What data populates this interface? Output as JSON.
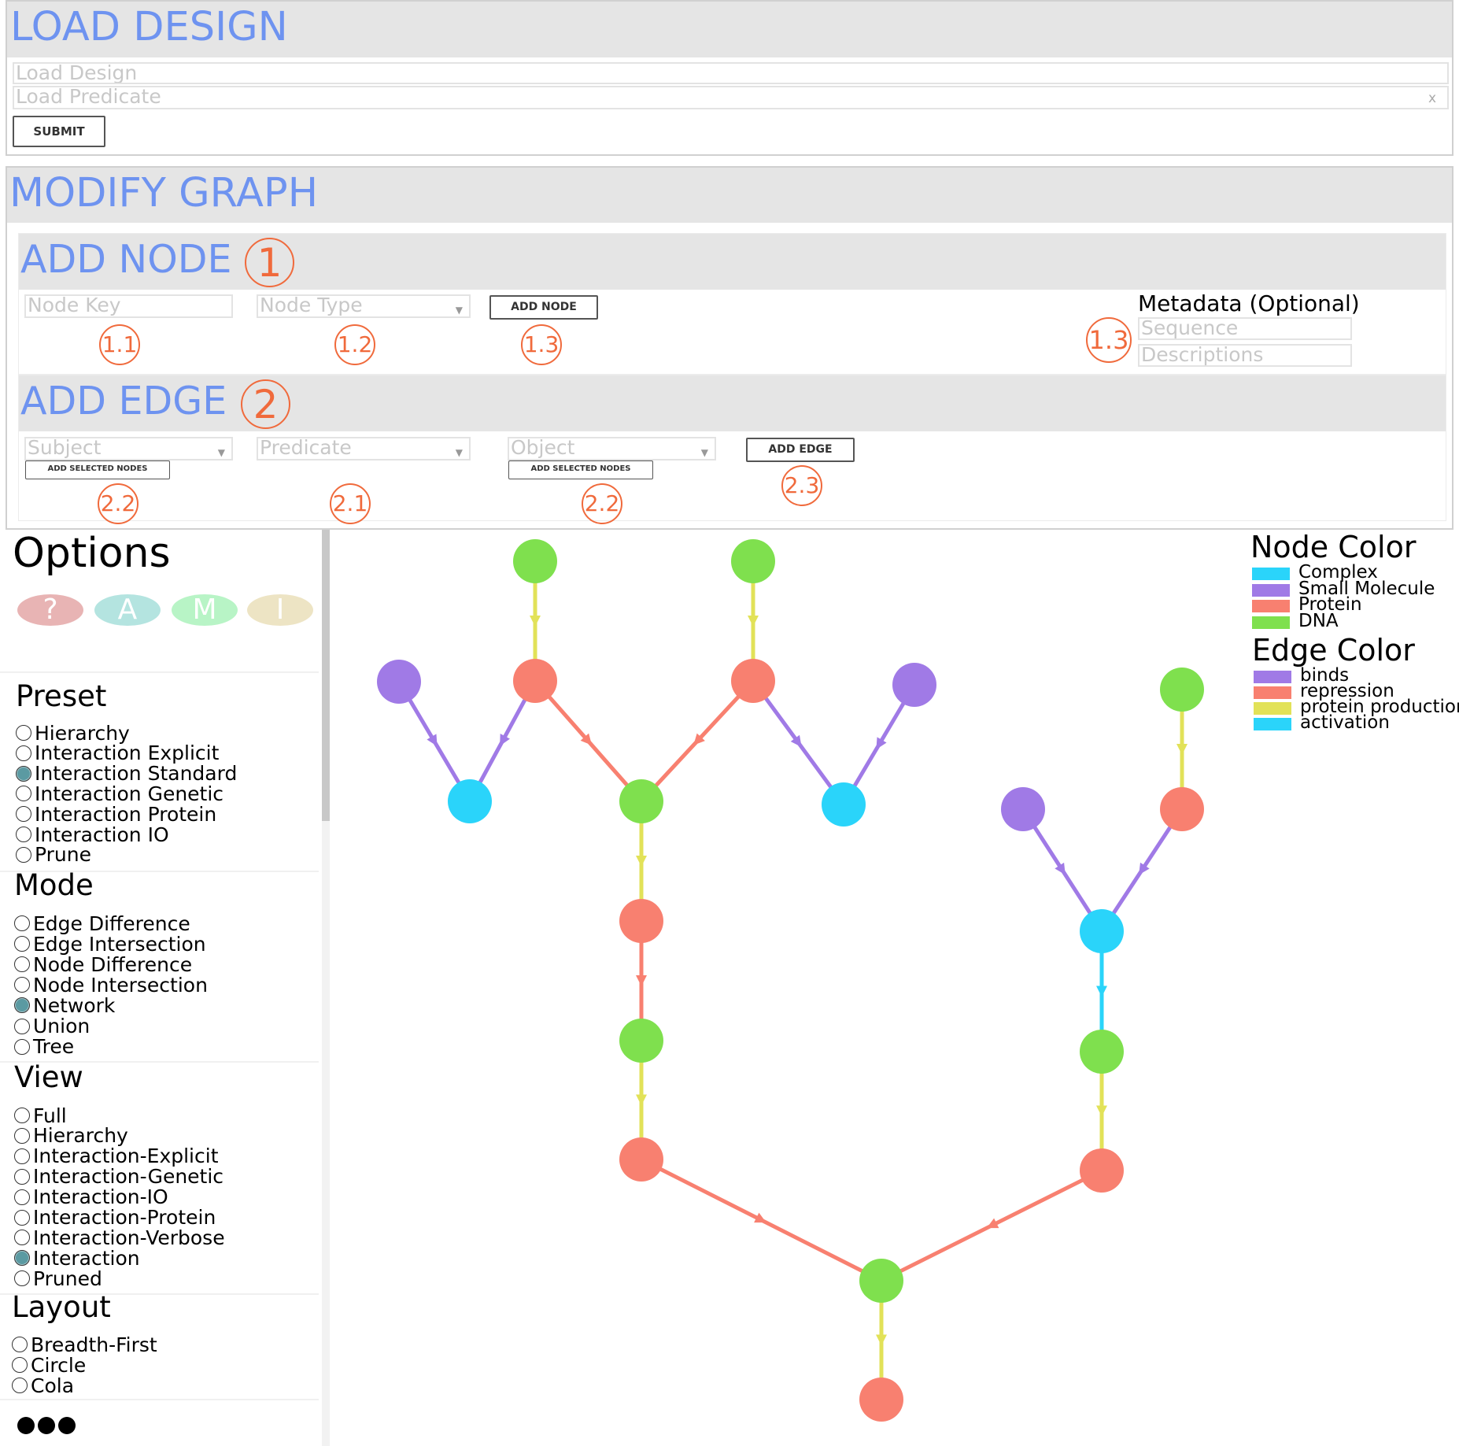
{
  "load_design": {
    "title": "LOAD DESIGN",
    "design_placeholder": "Load Design",
    "predicate_placeholder": "Load Predicate",
    "clear_label": "x",
    "submit_label": "SUBMIT"
  },
  "modify_graph": {
    "title": "MODIFY GRAPH",
    "add_node": {
      "title": "ADD NODE",
      "step": "1",
      "node_key_placeholder": "Node Key",
      "node_type_placeholder": "Node Type",
      "add_node_label": "ADD NODE",
      "metadata_title": "Metadata (Optional)",
      "sequence_placeholder": "Sequence",
      "descriptions_placeholder": "Descriptions",
      "annotations": [
        "1.1",
        "1.2",
        "1.3",
        "1.3"
      ]
    },
    "add_edge": {
      "title": "ADD EDGE",
      "step": "2",
      "subject_placeholder": "Subject",
      "predicate_placeholder": "Predicate",
      "object_placeholder": "Object",
      "add_selected_label": "ADD SELECTED NODES",
      "add_edge_label": "ADD EDGE",
      "annotations": [
        "2.2",
        "2.1",
        "2.2",
        "2.3"
      ]
    }
  },
  "options": {
    "title": "Options",
    "pills": [
      {
        "label": "?",
        "color": "#e8b4b4"
      },
      {
        "label": "A",
        "color": "#b4e4e0"
      },
      {
        "label": "M",
        "color": "#b8f4c6"
      },
      {
        "label": "I",
        "color": "#ede4c4"
      }
    ],
    "groups": [
      {
        "title": "Preset",
        "items": [
          "Hierarchy",
          "Interaction Explicit",
          "Interaction Standard",
          "Interaction Genetic",
          "Interaction Protein",
          "Interaction IO",
          "Prune"
        ],
        "selected": "Interaction Standard"
      },
      {
        "title": "Mode",
        "items": [
          "Edge Difference",
          "Edge Intersection",
          "Node Difference",
          "Node Intersection",
          "Network",
          "Union",
          "Tree"
        ],
        "selected": "Network"
      },
      {
        "title": "View",
        "items": [
          "Full",
          "Hierarchy",
          "Interaction-Explicit",
          "Interaction-Genetic",
          "Interaction-IO",
          "Interaction-Protein",
          "Interaction-Verbose",
          "Interaction",
          "Pruned"
        ],
        "selected": "Interaction"
      },
      {
        "title": "Layout",
        "items": [
          "Breadth-First",
          "Circle",
          "Cola"
        ],
        "selected": null
      }
    ],
    "more_icon": "more-dots-icon"
  },
  "legend": {
    "node_title": "Node Color",
    "node_items": [
      {
        "label": "Complex",
        "color": "#2ad4fa"
      },
      {
        "label": "Small Molecule",
        "color": "#a07ae6"
      },
      {
        "label": "Protein",
        "color": "#f88070"
      },
      {
        "label": "DNA",
        "color": "#7fe04e"
      }
    ],
    "edge_title": "Edge Color",
    "edge_items": [
      {
        "label": "binds",
        "color": "#a07ae6"
      },
      {
        "label": "repression",
        "color": "#f88070"
      },
      {
        "label": "protein production",
        "color": "#e2e258"
      },
      {
        "label": "activation",
        "color": "#2ad4fa"
      }
    ]
  },
  "graph": {
    "nodes": [
      {
        "id": "n1",
        "type": "DNA"
      },
      {
        "id": "n2",
        "type": "DNA"
      },
      {
        "id": "n3",
        "type": "Small Molecule"
      },
      {
        "id": "n4",
        "type": "Protein"
      },
      {
        "id": "n5",
        "type": "Protein"
      },
      {
        "id": "n6",
        "type": "Small Molecule"
      },
      {
        "id": "n7",
        "type": "Complex"
      },
      {
        "id": "n8",
        "type": "DNA"
      },
      {
        "id": "n9",
        "type": "Complex"
      },
      {
        "id": "n10",
        "type": "Protein"
      },
      {
        "id": "n11",
        "type": "DNA"
      },
      {
        "id": "n12",
        "type": "Protein"
      },
      {
        "id": "n13",
        "type": "DNA"
      },
      {
        "id": "n14",
        "type": "Protein"
      },
      {
        "id": "n15",
        "type": "DNA"
      },
      {
        "id": "n16",
        "type": "Small Molecule"
      },
      {
        "id": "n17",
        "type": "Protein"
      },
      {
        "id": "n18",
        "type": "Complex"
      },
      {
        "id": "n19",
        "type": "DNA"
      },
      {
        "id": "n20",
        "type": "Protein"
      }
    ],
    "edges": [
      {
        "from": "n1",
        "to": "n4",
        "type": "protein production"
      },
      {
        "from": "n2",
        "to": "n5",
        "type": "protein production"
      },
      {
        "from": "n3",
        "to": "n7",
        "type": "binds"
      },
      {
        "from": "n4",
        "to": "n7",
        "type": "binds"
      },
      {
        "from": "n4",
        "to": "n8",
        "type": "repression"
      },
      {
        "from": "n5",
        "to": "n8",
        "type": "repression"
      },
      {
        "from": "n5",
        "to": "n9",
        "type": "binds"
      },
      {
        "from": "n6",
        "to": "n9",
        "type": "binds"
      },
      {
        "from": "n8",
        "to": "n10",
        "type": "protein production"
      },
      {
        "from": "n10",
        "to": "n11",
        "type": "repression"
      },
      {
        "from": "n11",
        "to": "n12",
        "type": "protein production"
      },
      {
        "from": "n12",
        "to": "n13",
        "type": "repression"
      },
      {
        "from": "n13",
        "to": "n14",
        "type": "protein production"
      },
      {
        "from": "n15",
        "to": "n17",
        "type": "protein production"
      },
      {
        "from": "n16",
        "to": "n18",
        "type": "binds"
      },
      {
        "from": "n17",
        "to": "n18",
        "type": "binds"
      },
      {
        "from": "n18",
        "to": "n19",
        "type": "activation"
      },
      {
        "from": "n19",
        "to": "n20",
        "type": "protein production"
      },
      {
        "from": "n20",
        "to": "n13",
        "type": "repression"
      }
    ]
  }
}
